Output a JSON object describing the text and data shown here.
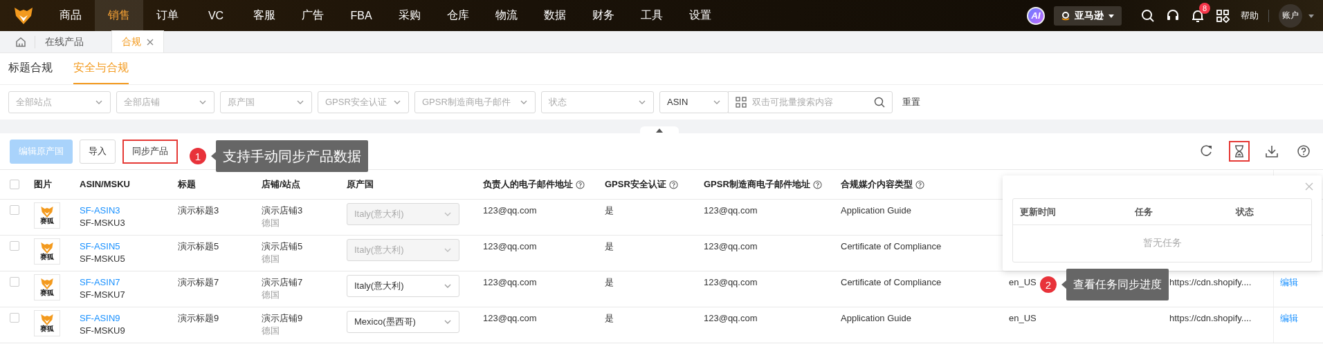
{
  "top_nav": {
    "items": [
      {
        "label": "商品",
        "selected": false
      },
      {
        "label": "销售",
        "selected": true
      },
      {
        "label": "订单",
        "selected": false
      },
      {
        "label": "VC",
        "selected": false
      },
      {
        "label": "客服",
        "selected": false
      },
      {
        "label": "广告",
        "selected": false
      },
      {
        "label": "FBA",
        "selected": false
      },
      {
        "label": "采购",
        "selected": false
      },
      {
        "label": "仓库",
        "selected": false
      },
      {
        "label": "物流",
        "selected": false
      },
      {
        "label": "数据",
        "selected": false
      },
      {
        "label": "财务",
        "selected": false
      },
      {
        "label": "工具",
        "selected": false
      },
      {
        "label": "设置",
        "selected": false
      }
    ],
    "ai_badge": "AI",
    "platform": "亚马逊",
    "notifications": "8",
    "help": "帮助",
    "account": "账户"
  },
  "page_tabs": [
    {
      "label": "在线产品",
      "selected": false,
      "closable": false
    },
    {
      "label": "合规",
      "selected": true,
      "closable": true
    }
  ],
  "sub_tabs": [
    {
      "label": "标题合规",
      "selected": false
    },
    {
      "label": "安全与合规",
      "selected": true
    }
  ],
  "filters": [
    {
      "kind": "select",
      "placeholder": "全部站点"
    },
    {
      "kind": "select",
      "placeholder": "全部店铺"
    },
    {
      "kind": "select",
      "placeholder": "原产国"
    },
    {
      "kind": "select",
      "placeholder": "GPSR安全认证"
    },
    {
      "kind": "select",
      "placeholder": "GPSR制造商电子邮件"
    },
    {
      "kind": "select",
      "placeholder": "状态"
    },
    {
      "kind": "select",
      "value": "ASIN"
    },
    {
      "kind": "search",
      "placeholder": "双击可批量搜索内容"
    }
  ],
  "reset": "重置",
  "toolbar": {
    "buttons": [
      {
        "label": "编辑原产国",
        "disabled": true,
        "highlighted": false
      },
      {
        "label": "导入",
        "disabled": false,
        "highlighted": false
      },
      {
        "label": "同步产品",
        "disabled": false,
        "highlighted": true
      }
    ],
    "tools": [
      {
        "kind": "refresh",
        "highlighted": false
      },
      {
        "kind": "tasks",
        "highlighted": true
      },
      {
        "kind": "download",
        "highlighted": false
      },
      {
        "kind": "help",
        "highlighted": false
      }
    ]
  },
  "annotations": [
    {
      "number": "1",
      "text": "支持手动同步产品数据"
    },
    {
      "number": "2",
      "text": "查看任务同步进度"
    }
  ],
  "table": {
    "all_checked": false,
    "columns": [
      {
        "label": "图片",
        "help": false
      },
      {
        "label": "ASIN/MSKU",
        "help": false
      },
      {
        "label": "标题",
        "help": false
      },
      {
        "label": "店铺/站点",
        "help": false
      },
      {
        "label": "原产国",
        "help": false
      },
      {
        "label": "负责人的电子邮件地址",
        "help": true
      },
      {
        "label": "GPSR安全认证",
        "help": true
      },
      {
        "label": "GPSR制造商电子邮件地址",
        "help": true
      },
      {
        "label": "合规媒介内容类型",
        "help": true
      }
    ],
    "rows": [
      {
        "checked": false,
        "image_label": "赛狐",
        "asin": "SF-ASIN3",
        "msku": "SF-MSKU3",
        "title": "演示标题3",
        "store": "演示店铺3",
        "site": "德国",
        "origin": "Italy(意大利)",
        "origin_disabled": true,
        "email": "123@qq.com",
        "gpsr": "是",
        "mfr_email": "123@qq.com",
        "media_type": "Application Guide"
      },
      {
        "checked": false,
        "image_label": "赛狐",
        "asin": "SF-ASIN5",
        "msku": "SF-MSKU5",
        "title": "演示标题5",
        "store": "演示店铺5",
        "site": "德国",
        "origin": "Italy(意大利)",
        "origin_disabled": true,
        "email": "123@qq.com",
        "gpsr": "是",
        "mfr_email": "123@qq.com",
        "media_type": "Certificate of Compliance"
      },
      {
        "checked": false,
        "image_label": "赛狐",
        "asin": "SF-ASIN7",
        "msku": "SF-MSKU7",
        "title": "演示标题7",
        "store": "演示店铺7",
        "site": "德国",
        "origin": "Italy(意大利)",
        "origin_disabled": false,
        "email": "123@qq.com",
        "gpsr": "是",
        "mfr_email": "123@qq.com",
        "media_type": "Certificate of Compliance",
        "language": "en_US",
        "url": "https://cdn.shopify....",
        "action": "编辑"
      },
      {
        "checked": false,
        "image_label": "赛狐",
        "asin": "SF-ASIN9",
        "msku": "SF-MSKU9",
        "title": "演示标题9",
        "store": "演示店铺9",
        "site": "德国",
        "origin": "Mexico(墨西哥)",
        "origin_disabled": false,
        "email": "123@qq.com",
        "gpsr": "是",
        "mfr_email": "123@qq.com",
        "media_type": "Application Guide",
        "language": "en_US",
        "url": "https://cdn.shopify....",
        "action": "编辑"
      }
    ]
  },
  "task_popup": {
    "columns": [
      "更新时间",
      "任务",
      "状态"
    ],
    "empty": "暂无任务"
  }
}
